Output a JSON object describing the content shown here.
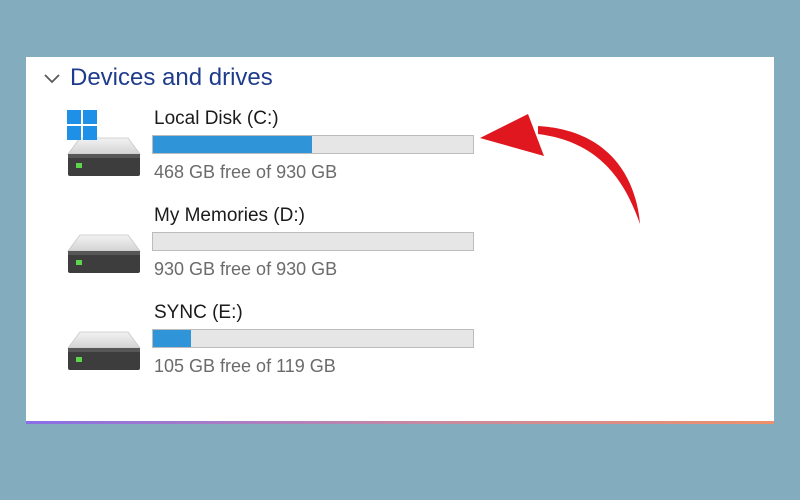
{
  "group": {
    "title": "Devices and drives"
  },
  "drives": [
    {
      "label": "Local Disk (C:)",
      "free_text": "468 GB free of 930 GB",
      "used_fraction": 0.497,
      "is_system": true
    },
    {
      "label": "My Memories (D:)",
      "free_text": "930 GB free of 930 GB",
      "used_fraction": 0.0,
      "is_system": false
    },
    {
      "label": "SYNC (E:)",
      "free_text": "105 GB free of 119 GB",
      "used_fraction": 0.118,
      "is_system": false
    }
  ],
  "colors": {
    "background": "#84acbf",
    "accent": "#2f95d8",
    "header_text": "#1f3c8c",
    "annotation_arrow": "#e0171f",
    "windows_logo": "#1e90e8"
  },
  "icons": {
    "group_toggle": "chevron-down-icon",
    "drive": "hard-drive-icon",
    "system_badge": "windows-logo-icon",
    "annotation": "curved-arrow-icon"
  }
}
